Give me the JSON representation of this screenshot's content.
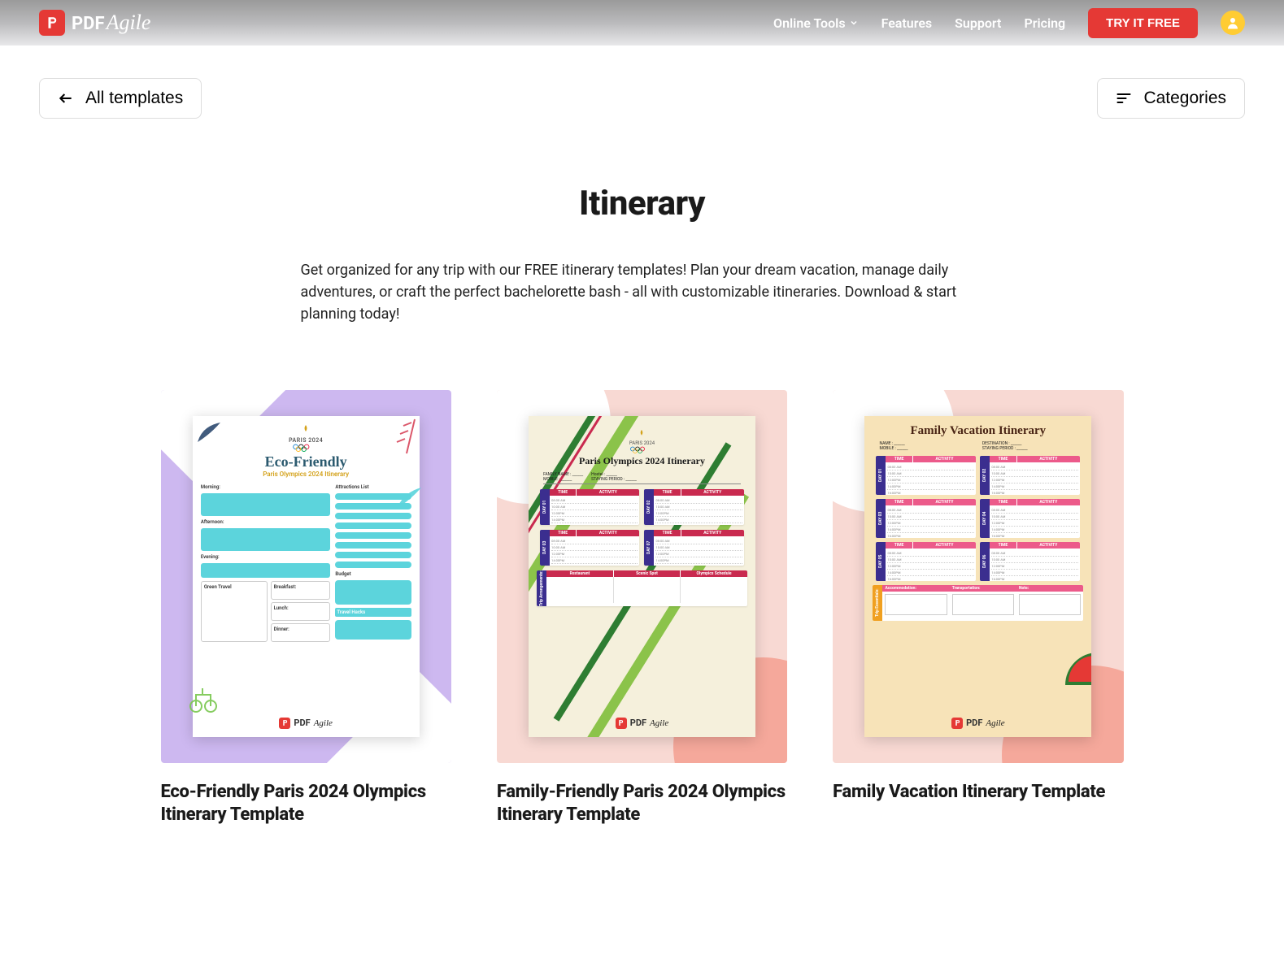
{
  "brand": {
    "name_bold": "PDF",
    "name_script": "Agile"
  },
  "nav": {
    "online_tools": "Online Tools",
    "features": "Features",
    "support": "Support",
    "pricing": "Pricing",
    "try_free": "TRY IT FREE"
  },
  "toolbar": {
    "back_label": "All templates",
    "categories_label": "Categories"
  },
  "hero": {
    "title": "Itinerary",
    "description": "Get organized for any trip with our FREE itinerary templates! Plan your dream vacation, manage daily adventures, or craft the perfect bachelorette bash - all with customizable itineraries. Download & start planning today!"
  },
  "cards": [
    {
      "title": "Eco-Friendly Paris 2024 Olympics Itinerary Template"
    },
    {
      "title": "Family-Friendly Paris 2024 Olympics Itinerary Template"
    },
    {
      "title": "Family Vacation Itinerary Template"
    }
  ],
  "doc_eco": {
    "paris": "PARIS 2024",
    "title": "Eco-Friendly",
    "sub": "Paris Olympics 2024 Itinerary",
    "morning": "Morning:",
    "afternoon": "Afternoon:",
    "evening": "Evening:",
    "attractions": "Attractions List",
    "green_travel": "Green Travel",
    "breakfast": "Breakfast:",
    "lunch": "Lunch:",
    "dinner": "Dinner:",
    "budget": "Budget",
    "hacks": "Travel Hacks"
  },
  "doc_oly": {
    "paris": "PARIS 2024",
    "title": "Paris Olympics 2024 Itinerary",
    "family": "FAMILY NAME :",
    "mobile": "MOBILE :",
    "hostel": "Hostel :",
    "period": "STAYING PERIOD :",
    "time": "TIME",
    "activity": "ACTIVITY",
    "days": [
      "DAY 01",
      "DAY 02",
      "DAY 03",
      "DAY 07"
    ],
    "arrangements": "Trip Arrangements:",
    "restaurant": "Restaurant",
    "scenic": "Scenic Spot",
    "schedule": "Olympics Schedule",
    "times": [
      "08:00 AM",
      "10:00 AM",
      "12:00PM",
      "14:00PM",
      "16:00PM"
    ]
  },
  "doc_vac": {
    "title": "Family Vacation Itinerary",
    "name": "NAME :",
    "mobile": "MOBILE :",
    "destination": "DESTINATION :",
    "period": "STAYING PERIOD :",
    "time": "TIME",
    "activity": "ACTIVITY",
    "days": [
      "DAY 01",
      "DAY 02",
      "DAY 03",
      "DAY 04",
      "DAY 05",
      "DAY 06"
    ],
    "essentials": "Trip Essentials:",
    "accommodation": "Accommodation:",
    "transportation": "Transportation:",
    "note": "Note:",
    "times": [
      "08:00 AM",
      "10:00 AM",
      "12:00PM",
      "14:00PM",
      "16:00PM"
    ]
  }
}
